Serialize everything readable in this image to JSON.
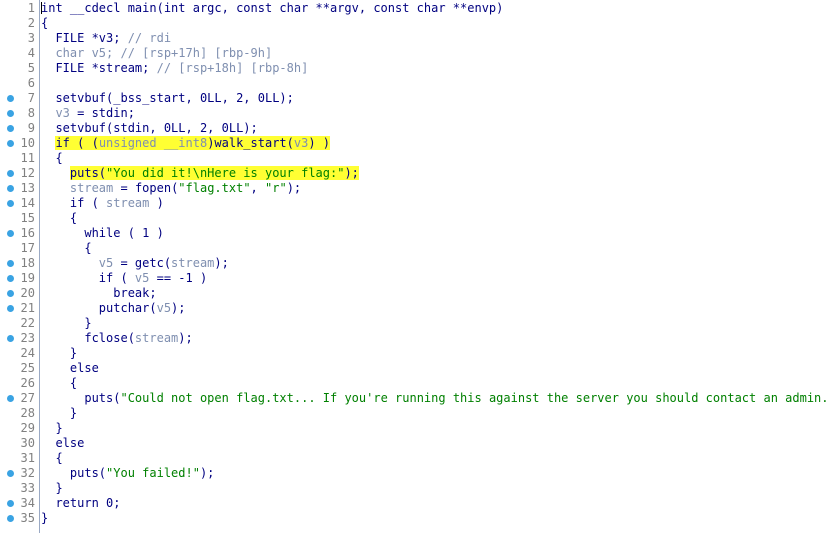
{
  "lines": [
    {
      "n": "1",
      "bp": false,
      "segs": [
        {
          "t": "int __cdecl main(int argc, const char **argv, const char **envp)",
          "c": "k"
        }
      ]
    },
    {
      "n": "2",
      "bp": false,
      "segs": [
        {
          "t": "{",
          "c": "k"
        }
      ]
    },
    {
      "n": "3",
      "bp": false,
      "segs": [
        {
          "t": "  FILE *v3; ",
          "c": "k"
        },
        {
          "t": "// rdi",
          "c": "cm"
        }
      ]
    },
    {
      "n": "4",
      "bp": false,
      "segs": [
        {
          "t": "  char ",
          "c": "g"
        },
        {
          "t": "v5",
          "c": "g"
        },
        {
          "t": "; // [rsp+17h] [rbp-9h]",
          "c": "g"
        }
      ]
    },
    {
      "n": "5",
      "bp": false,
      "segs": [
        {
          "t": "  FILE *stream; ",
          "c": "k"
        },
        {
          "t": "// [rsp+18h] [rbp-8h]",
          "c": "cm"
        }
      ]
    },
    {
      "n": "6",
      "bp": false,
      "segs": []
    },
    {
      "n": "7",
      "bp": true,
      "segs": [
        {
          "t": "  setvbuf(_bss_start, 0LL, 2, 0LL);",
          "c": "k"
        }
      ]
    },
    {
      "n": "8",
      "bp": true,
      "segs": [
        {
          "t": "  ",
          "c": "k"
        },
        {
          "t": "v3",
          "c": "g"
        },
        {
          "t": " = stdin;",
          "c": "k"
        }
      ]
    },
    {
      "n": "9",
      "bp": true,
      "segs": [
        {
          "t": "  setvbuf(stdin, 0LL, 2, 0LL);",
          "c": "k"
        }
      ]
    },
    {
      "n": "10",
      "bp": true,
      "hlFrom": 1,
      "segs": [
        {
          "t": "  ",
          "c": "k"
        },
        {
          "t": "if ( (",
          "c": "k"
        },
        {
          "t": "unsigned __int8",
          "c": "g"
        },
        {
          "t": ")walk_start(",
          "c": "k"
        },
        {
          "t": "v3",
          "c": "g"
        },
        {
          "t": ") )",
          "c": "k"
        }
      ]
    },
    {
      "n": "11",
      "bp": false,
      "segs": [
        {
          "t": "  {",
          "c": "k"
        }
      ]
    },
    {
      "n": "12",
      "bp": true,
      "hlFrom": 1,
      "segs": [
        {
          "t": "    ",
          "c": "k"
        },
        {
          "t": "puts(",
          "c": "k"
        },
        {
          "t": "\"You did it!\\nHere is your flag:\"",
          "c": "s"
        },
        {
          "t": ");",
          "c": "k"
        }
      ]
    },
    {
      "n": "13",
      "bp": true,
      "segs": [
        {
          "t": "    ",
          "c": "k"
        },
        {
          "t": "stream",
          "c": "g"
        },
        {
          "t": " = fopen(",
          "c": "k"
        },
        {
          "t": "\"flag.txt\"",
          "c": "s"
        },
        {
          "t": ", ",
          "c": "k"
        },
        {
          "t": "\"r\"",
          "c": "s"
        },
        {
          "t": ");",
          "c": "k"
        }
      ]
    },
    {
      "n": "14",
      "bp": true,
      "segs": [
        {
          "t": "    if ( ",
          "c": "k"
        },
        {
          "t": "stream",
          "c": "g"
        },
        {
          "t": " )",
          "c": "k"
        }
      ]
    },
    {
      "n": "15",
      "bp": false,
      "segs": [
        {
          "t": "    {",
          "c": "k"
        }
      ]
    },
    {
      "n": "16",
      "bp": true,
      "segs": [
        {
          "t": "      while ( 1 )",
          "c": "k"
        }
      ]
    },
    {
      "n": "17",
      "bp": false,
      "segs": [
        {
          "t": "      {",
          "c": "k"
        }
      ]
    },
    {
      "n": "18",
      "bp": true,
      "segs": [
        {
          "t": "        ",
          "c": "k"
        },
        {
          "t": "v5",
          "c": "g"
        },
        {
          "t": " = getc(",
          "c": "k"
        },
        {
          "t": "stream",
          "c": "g"
        },
        {
          "t": ");",
          "c": "k"
        }
      ]
    },
    {
      "n": "19",
      "bp": true,
      "segs": [
        {
          "t": "        if ( ",
          "c": "k"
        },
        {
          "t": "v5",
          "c": "g"
        },
        {
          "t": " == -1 )",
          "c": "k"
        }
      ]
    },
    {
      "n": "20",
      "bp": true,
      "segs": [
        {
          "t": "          break;",
          "c": "k"
        }
      ]
    },
    {
      "n": "21",
      "bp": true,
      "segs": [
        {
          "t": "        putchar(",
          "c": "k"
        },
        {
          "t": "v5",
          "c": "g"
        },
        {
          "t": ");",
          "c": "k"
        }
      ]
    },
    {
      "n": "22",
      "bp": false,
      "segs": [
        {
          "t": "      }",
          "c": "k"
        }
      ]
    },
    {
      "n": "23",
      "bp": true,
      "segs": [
        {
          "t": "      fclose(",
          "c": "k"
        },
        {
          "t": "stream",
          "c": "g"
        },
        {
          "t": ");",
          "c": "k"
        }
      ]
    },
    {
      "n": "24",
      "bp": false,
      "segs": [
        {
          "t": "    }",
          "c": "k"
        }
      ]
    },
    {
      "n": "25",
      "bp": false,
      "segs": [
        {
          "t": "    else",
          "c": "k"
        }
      ]
    },
    {
      "n": "26",
      "bp": false,
      "segs": [
        {
          "t": "    {",
          "c": "k"
        }
      ]
    },
    {
      "n": "27",
      "bp": true,
      "segs": [
        {
          "t": "      puts(",
          "c": "k"
        },
        {
          "t": "\"Could not open flag.txt... If you're running this against the server you should contact an admin.\"",
          "c": "s"
        },
        {
          "t": ");",
          "c": "k"
        }
      ]
    },
    {
      "n": "28",
      "bp": false,
      "segs": [
        {
          "t": "    }",
          "c": "k"
        }
      ]
    },
    {
      "n": "29",
      "bp": false,
      "segs": [
        {
          "t": "  }",
          "c": "k"
        }
      ]
    },
    {
      "n": "30",
      "bp": false,
      "segs": [
        {
          "t": "  else",
          "c": "k"
        }
      ]
    },
    {
      "n": "31",
      "bp": false,
      "segs": [
        {
          "t": "  {",
          "c": "k"
        }
      ]
    },
    {
      "n": "32",
      "bp": true,
      "segs": [
        {
          "t": "    puts(",
          "c": "k"
        },
        {
          "t": "\"You failed!\"",
          "c": "s"
        },
        {
          "t": ");",
          "c": "k"
        }
      ]
    },
    {
      "n": "33",
      "bp": false,
      "segs": [
        {
          "t": "  }",
          "c": "k"
        }
      ]
    },
    {
      "n": "34",
      "bp": true,
      "segs": [
        {
          "t": "  return 0;",
          "c": "k"
        }
      ]
    },
    {
      "n": "35",
      "bp": true,
      "segs": [
        {
          "t": "}",
          "c": "k"
        }
      ]
    }
  ],
  "colors": {
    "code": "#000080",
    "comment": "#7f8fb0",
    "string": "#008000",
    "highlight": "#ffff33",
    "breakpoint": "#3aa3e3"
  }
}
